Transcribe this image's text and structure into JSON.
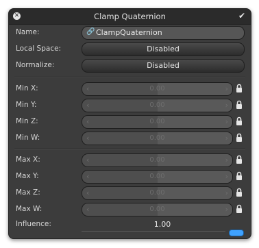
{
  "window": {
    "title": "Clamp Quaternion",
    "close_glyph": "✕",
    "confirm_glyph": "✔"
  },
  "fields": {
    "name": {
      "label": "Name:",
      "value": "ClampQuaternion",
      "icon": "link-icon"
    },
    "local_space": {
      "label": "Local Space:",
      "value": "Disabled"
    },
    "normalize": {
      "label": "Normalize:",
      "value": "Disabled"
    }
  },
  "min": [
    {
      "label": "Min X:",
      "value": "0.00"
    },
    {
      "label": "Min Y:",
      "value": "0.00"
    },
    {
      "label": "Min Z:",
      "value": "0.00"
    },
    {
      "label": "Min W:",
      "value": "0.00"
    }
  ],
  "max": [
    {
      "label": "Max X:",
      "value": "0.00"
    },
    {
      "label": "Max Y:",
      "value": "0.00"
    },
    {
      "label": "Max Z:",
      "value": "0.00"
    },
    {
      "label": "Max W:",
      "value": "0.00"
    }
  ],
  "influence": {
    "label": "Influence:",
    "value": "1.00"
  },
  "colors": {
    "accent": "#3fa2ff",
    "panel": "#3c3c3c"
  }
}
